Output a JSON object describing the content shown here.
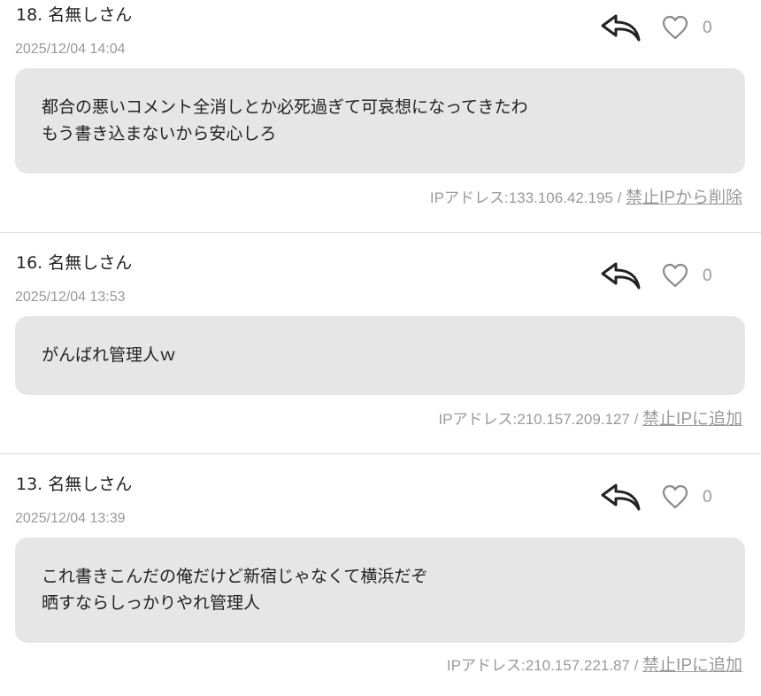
{
  "comments": [
    {
      "name": "18. 名無しさん",
      "date": "2025/12/04 14:04",
      "likes": "0",
      "body": [
        "都合の悪いコメント全消しとか必死過ぎて可哀想になってきたわ",
        "もう書き込まないから安心しろ"
      ],
      "ip_text": "IPアドレス:133.106.42.195 / ",
      "ip_action": "禁止IPから削除"
    },
    {
      "name": "16. 名無しさん",
      "date": "2025/12/04 13:53",
      "likes": "0",
      "body": [
        "がんばれ管理人ｗ"
      ],
      "ip_text": "IPアドレス:210.157.209.127 / ",
      "ip_action": "禁止IPに追加"
    },
    {
      "name": "13. 名無しさん",
      "date": "2025/12/04 13:39",
      "likes": "0",
      "body": [
        "これ書きこんだの俺だけど新宿じゃなくて横浜だぞ",
        "晒すならしっかりやれ管理人"
      ],
      "ip_text": "IPアドレス:210.157.221.87 / ",
      "ip_action": "禁止IPに追加"
    }
  ],
  "icons": {
    "reply": "reply-arrow-icon",
    "like": "heart-outline-icon"
  },
  "colors": {
    "bubble_bg": "#e6e6e6",
    "muted_text": "#999999",
    "divider": "#dddddd"
  }
}
